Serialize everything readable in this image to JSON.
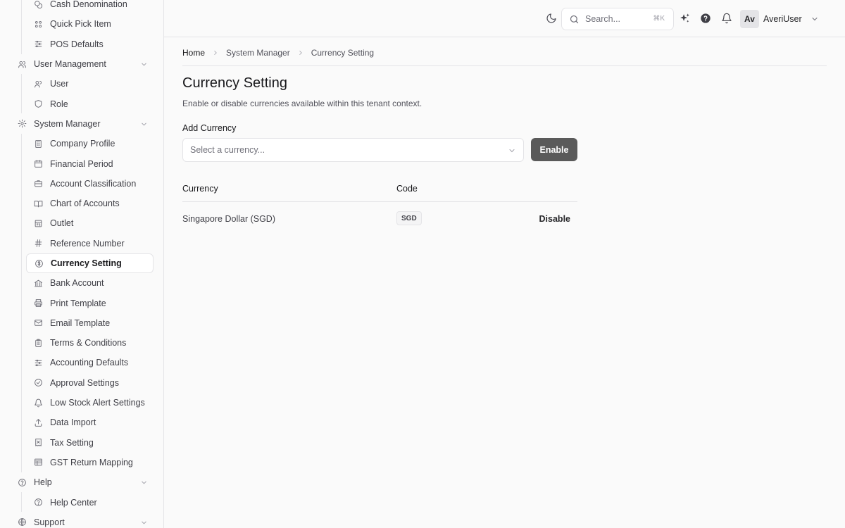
{
  "sidebar": {
    "items": [
      {
        "label": "Cash Denomination",
        "type": "sub",
        "icon": "coins-icon"
      },
      {
        "label": "Quick Pick Item",
        "type": "sub",
        "icon": "grid-icon"
      },
      {
        "label": "POS Defaults",
        "type": "sub",
        "icon": "sliders-icon"
      },
      {
        "label": "User Management",
        "type": "section",
        "icon": "users-icon"
      },
      {
        "label": "User",
        "type": "sub",
        "icon": "user-icon"
      },
      {
        "label": "Role",
        "type": "sub",
        "icon": "shield-icon"
      },
      {
        "label": "System Manager",
        "type": "section",
        "icon": "gear-icon"
      },
      {
        "label": "Company Profile",
        "type": "sub",
        "icon": "building-icon"
      },
      {
        "label": "Financial Period",
        "type": "sub",
        "icon": "calendar-icon"
      },
      {
        "label": "Account Classification",
        "type": "sub",
        "icon": "briefcase-icon"
      },
      {
        "label": "Chart of Accounts",
        "type": "sub",
        "icon": "book-icon"
      },
      {
        "label": "Outlet",
        "type": "sub",
        "icon": "store-icon"
      },
      {
        "label": "Reference Number",
        "type": "sub",
        "icon": "hash-icon"
      },
      {
        "label": "Currency Setting",
        "type": "sub",
        "icon": "currency-icon",
        "active": true
      },
      {
        "label": "Bank Account",
        "type": "sub",
        "icon": "bank-icon"
      },
      {
        "label": "Print Template",
        "type": "sub",
        "icon": "printer-icon"
      },
      {
        "label": "Email Template",
        "type": "sub",
        "icon": "mail-icon"
      },
      {
        "label": "Terms & Conditions",
        "type": "sub",
        "icon": "clipboard-icon"
      },
      {
        "label": "Accounting Defaults",
        "type": "sub",
        "icon": "sliders-icon"
      },
      {
        "label": "Approval Settings",
        "type": "sub",
        "icon": "check-circle-icon"
      },
      {
        "label": "Low Stock Alert Settings",
        "type": "sub",
        "icon": "bell-icon"
      },
      {
        "label": "Data Import",
        "type": "sub",
        "icon": "upload-icon"
      },
      {
        "label": "Tax Setting",
        "type": "sub",
        "icon": "receipt-icon"
      },
      {
        "label": "GST Return Mapping",
        "type": "sub",
        "icon": "table-icon"
      },
      {
        "label": "Help",
        "type": "section",
        "icon": "help-circle-icon"
      },
      {
        "label": "Help Center",
        "type": "sub",
        "icon": "help-circle-icon"
      },
      {
        "label": "Support",
        "type": "section",
        "icon": "globe-icon"
      }
    ]
  },
  "topbar": {
    "search_placeholder": "Search...",
    "search_shortcut": "⌘K",
    "avatar_initials": "Av",
    "username": "AveriUser"
  },
  "breadcrumb": {
    "home": "Home",
    "parent": "System Manager",
    "current": "Currency Setting"
  },
  "page": {
    "title": "Currency Setting",
    "subtitle": "Enable or disable currencies available within this tenant context.",
    "add_label": "Add Currency",
    "select_placeholder": "Select a currency...",
    "enable_label": "Enable"
  },
  "table": {
    "headers": {
      "currency": "Currency",
      "code": "Code"
    },
    "rows": [
      {
        "currency": "Singapore Dollar (SGD)",
        "code": "SGD",
        "action": "Disable"
      }
    ]
  }
}
